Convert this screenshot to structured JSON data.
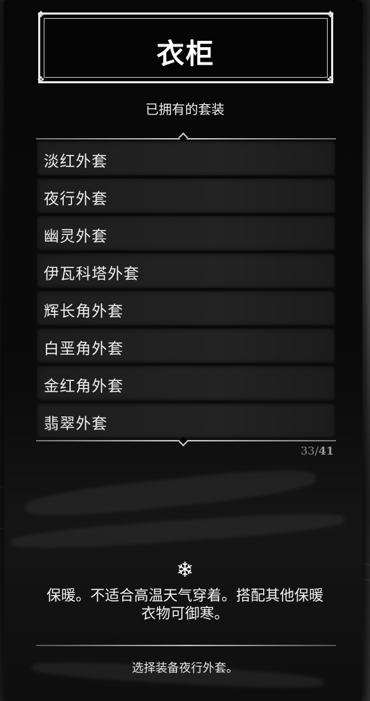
{
  "window": {
    "title": "衣柜",
    "subtitle": "已拥有的套装"
  },
  "outfits": [
    {
      "label": "淡红外套"
    },
    {
      "label": "夜行外套"
    },
    {
      "label": "幽灵外套"
    },
    {
      "label": "伊瓦科塔外套"
    },
    {
      "label": "辉长角外套"
    },
    {
      "label": "白垩角外套"
    },
    {
      "label": "金红角外套"
    },
    {
      "label": "翡翠外套"
    }
  ],
  "pagination": {
    "current": "33",
    "separator": "/",
    "total": "41"
  },
  "details": {
    "icon": "snowflake-icon",
    "description": "保暖。不适合高温天气穿着。搭配其他保暖衣物可御寒。"
  },
  "footer": {
    "hint": "选择装备夜行外套。"
  },
  "colors": {
    "panel": "#0a0a0a",
    "item_bg": "#1f1f1f",
    "text": "#f2f2f2",
    "muted": "#8e8e8e"
  }
}
